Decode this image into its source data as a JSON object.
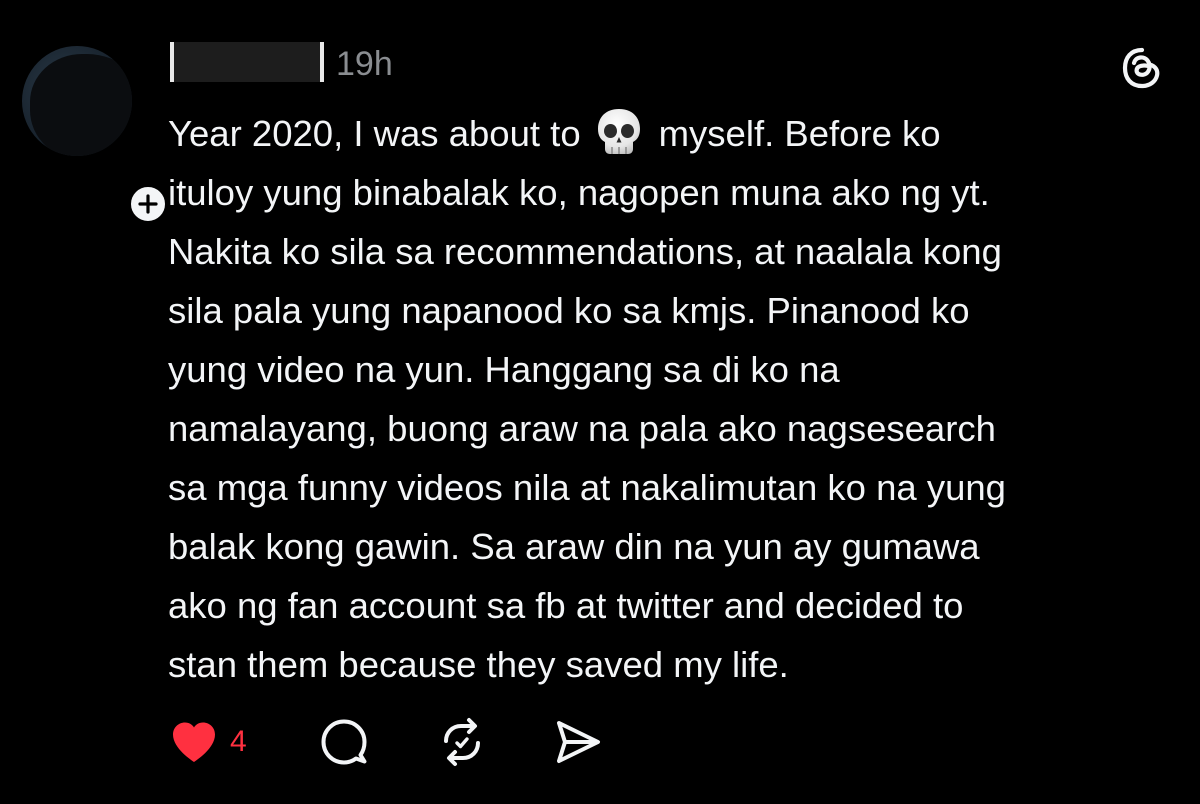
{
  "post": {
    "timestamp": "19h",
    "body_lines": [
      [
        "Year 2020, I was about to",
        "myself. Before ko"
      ],
      "ituloy yung binabalak ko, nagopen muna ako ng yt.",
      "Nakita ko sila sa recommendations, at naalala kong",
      "sila pala yung napanood ko sa kmjs. Pinanood ko",
      "yung video na yun. Hanggang sa di ko na",
      "namalayang, buong araw na pala ako nagsesearch",
      "sa mga funny videos nila at nakalimutan ko na yung",
      "balak kong gawin. Sa araw din na yun ay gumawa",
      "ako ng fan account sa fb at twitter and decided to",
      "stan them because they saved my life."
    ],
    "line1_before_emoji": "Year 2020, I was about to",
    "line1_after_emoji": "myself. Before ko",
    "line2": "ituloy yung binabalak ko, nagopen muna ako ng yt.",
    "line3": "Nakita ko sila sa recommendations, at naalala kong",
    "line4": "sila pala yung napanood ko sa kmjs. Pinanood ko",
    "line5": "yung video na yun. Hanggang sa di ko na",
    "line6": "namalayang, buong araw na pala ako nagsesearch",
    "line7": "sa mga funny videos nila at nakalimutan ko na yung",
    "line8": "balak kong gawin. Sa araw din na yun ay gumawa",
    "line9": "ako ng fan account sa fb at twitter and decided to",
    "line10": "stan them because they saved my life.",
    "emoji": "skull-emoji",
    "actions": {
      "like_count": "4",
      "like_icon": "heart-filled-icon",
      "reply_icon": "reply-bubble-icon",
      "repost_icon": "repost-icon",
      "share_icon": "send-icon"
    }
  },
  "colors": {
    "background": "#000000",
    "text": "#f3f5f7",
    "muted": "#8a8d91",
    "like": "#ff3040"
  }
}
